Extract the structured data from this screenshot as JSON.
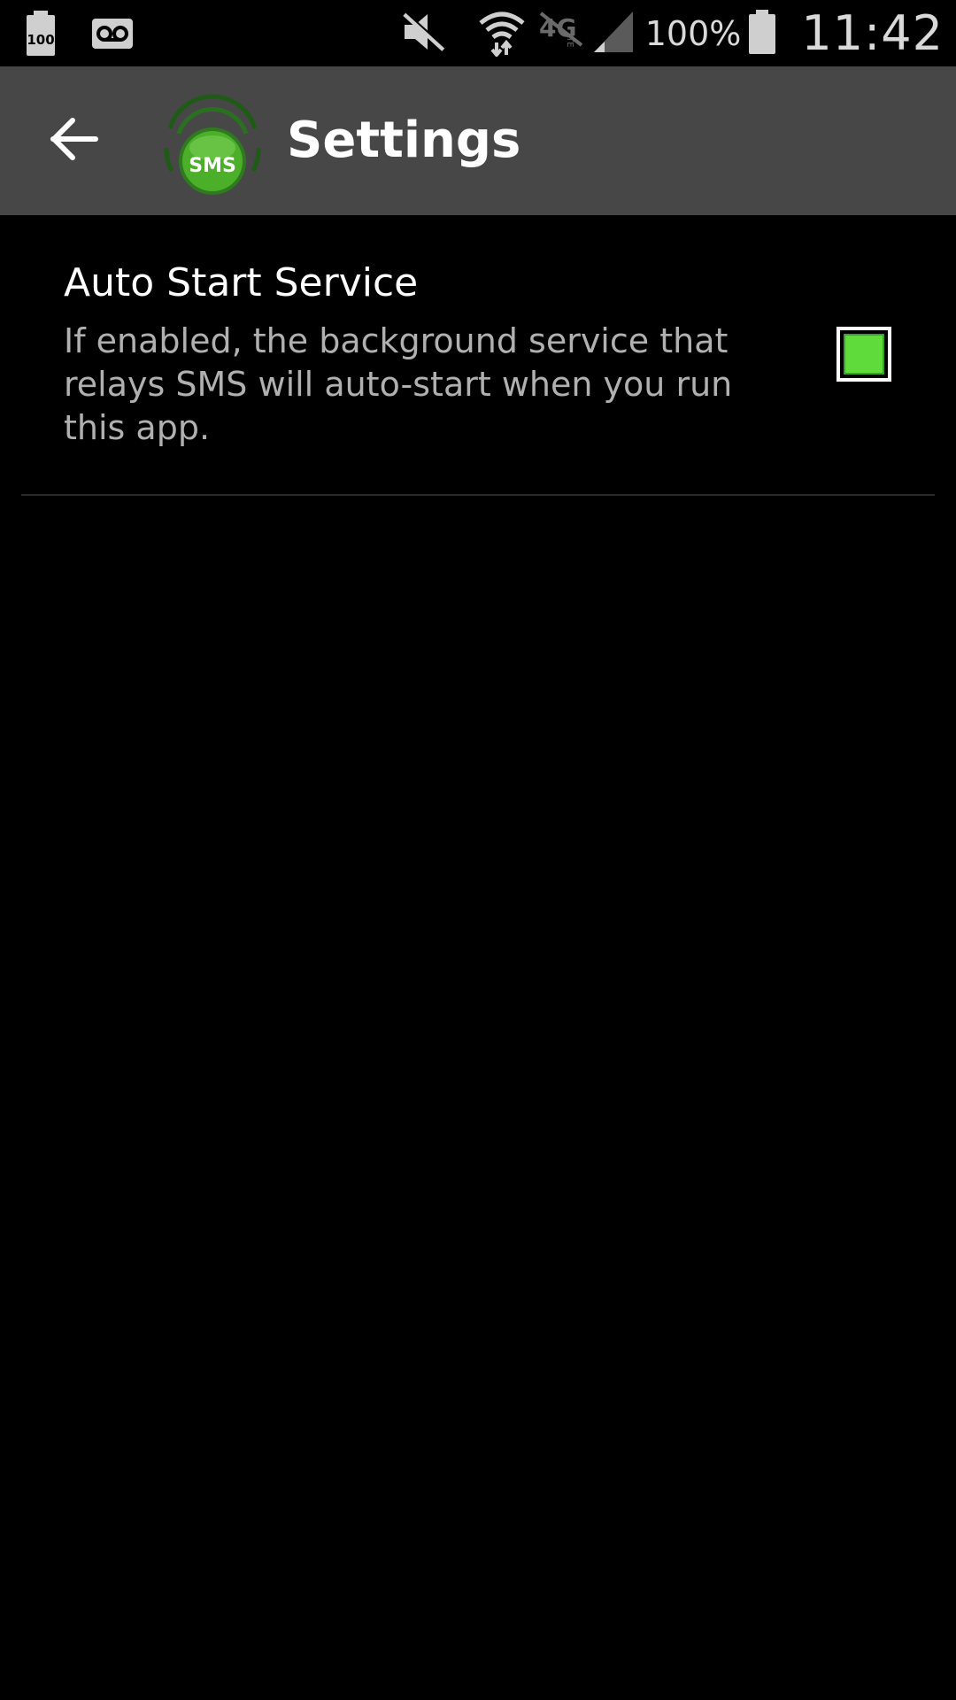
{
  "status_bar": {
    "battery_saver_label": "100",
    "battery_percent": "100%",
    "clock": "11:42",
    "icons": [
      "battery-100-icon",
      "voicemail-icon",
      "mute-icon",
      "wifi-icon",
      "4g-lte-icon",
      "signal-icon",
      "battery-icon"
    ]
  },
  "action_bar": {
    "title": "Settings",
    "logo_text": "SMS",
    "back_icon": "arrow-left-icon"
  },
  "preferences": [
    {
      "title": "Auto Start Service",
      "summary": "If enabled, the background service that relays SMS will auto-start when you run this app.",
      "checked": true
    }
  ],
  "colors": {
    "action_bar_bg": "#474747",
    "background": "#000000",
    "checkbox_fill": "#5fdc3c",
    "logo_green": "#4caf2a"
  }
}
